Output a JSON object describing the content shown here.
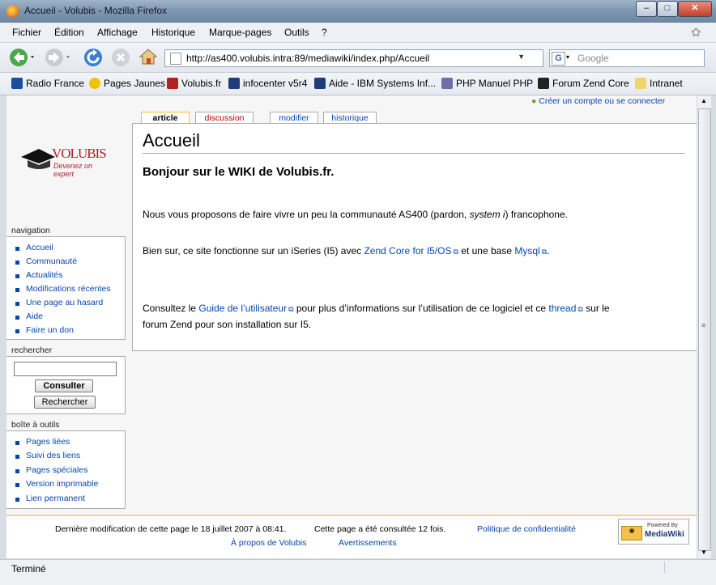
{
  "window": {
    "title": "Accueil - Volubis - Mozilla Firefox"
  },
  "menu": [
    "Fichier",
    "Édition",
    "Affichage",
    "Historique",
    "Marque-pages",
    "Outils",
    "?"
  ],
  "address": {
    "url": "http://as400.volubis.intra:89/mediawiki/index.php/Accueil",
    "search_placeholder": "Google"
  },
  "bookmarks": [
    "Radio France",
    "Pages Jaunes",
    "Volubis.fr",
    "infocenter v5r4",
    "Aide - IBM Systems Inf...",
    "PHP Manuel PHP",
    "Forum Zend Core",
    "Intranet"
  ],
  "bookmark_icons": [
    "radio-icon",
    "pages-jaunes-icon",
    "volubis-icon",
    "ibm-icon",
    "ibm-icon",
    "php-icon",
    "zend-icon",
    "folder-icon"
  ],
  "logo": {
    "brand": "VOLUBIS",
    "tagline": "Devenez un expert"
  },
  "user_link": "Créer un compte ou se connecter",
  "tabs": [
    "article",
    "discussion",
    "modifier",
    "historique"
  ],
  "sidebar": {
    "navigation_title": "navigation",
    "navigation": [
      "Accueil",
      "Communauté",
      "Actualités",
      "Modifications récentes",
      "Une page au hasard",
      "Aide",
      "Faire un don"
    ],
    "search_title": "rechercher",
    "search_go": "Consulter",
    "search_btn": "Rechercher",
    "tools_title": "boîte à outils",
    "tools": [
      "Pages liées",
      "Suivi des liens",
      "Pages spéciales",
      "Version imprimable",
      "Lien permanent"
    ]
  },
  "article": {
    "title": "Accueil",
    "heading": "Bonjour sur le WIKI de Volubis.fr.",
    "p1_a": "Nous vous proposons de faire vivre un peu la communauté AS400 (pardon, ",
    "p1_em": "system i",
    "p1_b": ") francophone.",
    "p2_a": "Bien sur, ce site fonctionne sur un iSeries (I5) avec ",
    "p2_link1": "Zend Core for I5/OS",
    "p2_b": " et une base ",
    "p2_link2": "Mysql",
    "p2_c": ".",
    "p3_a": "Consultez le ",
    "p3_link1": "Guide de l’utilisateur",
    "p3_b": " pour plus d’informations sur l’utilisation de ce logiciel et ce ",
    "p3_link2": "thread",
    "p3_c": " sur le",
    "p3_d": "forum Zend pour son installation sur I5."
  },
  "footer": {
    "lastmod": "Dernière modification de cette page le 18 juillet 2007 à 08:41.",
    "views": "Cette page a été consultée 12 fois.",
    "privacy": "Politique de confidentialité",
    "about": "À propos de Volubis",
    "disclaimer": "Avertissements",
    "powered_top": "Powered By",
    "powered_brand": "MediaWiki"
  },
  "status": "Terminé"
}
